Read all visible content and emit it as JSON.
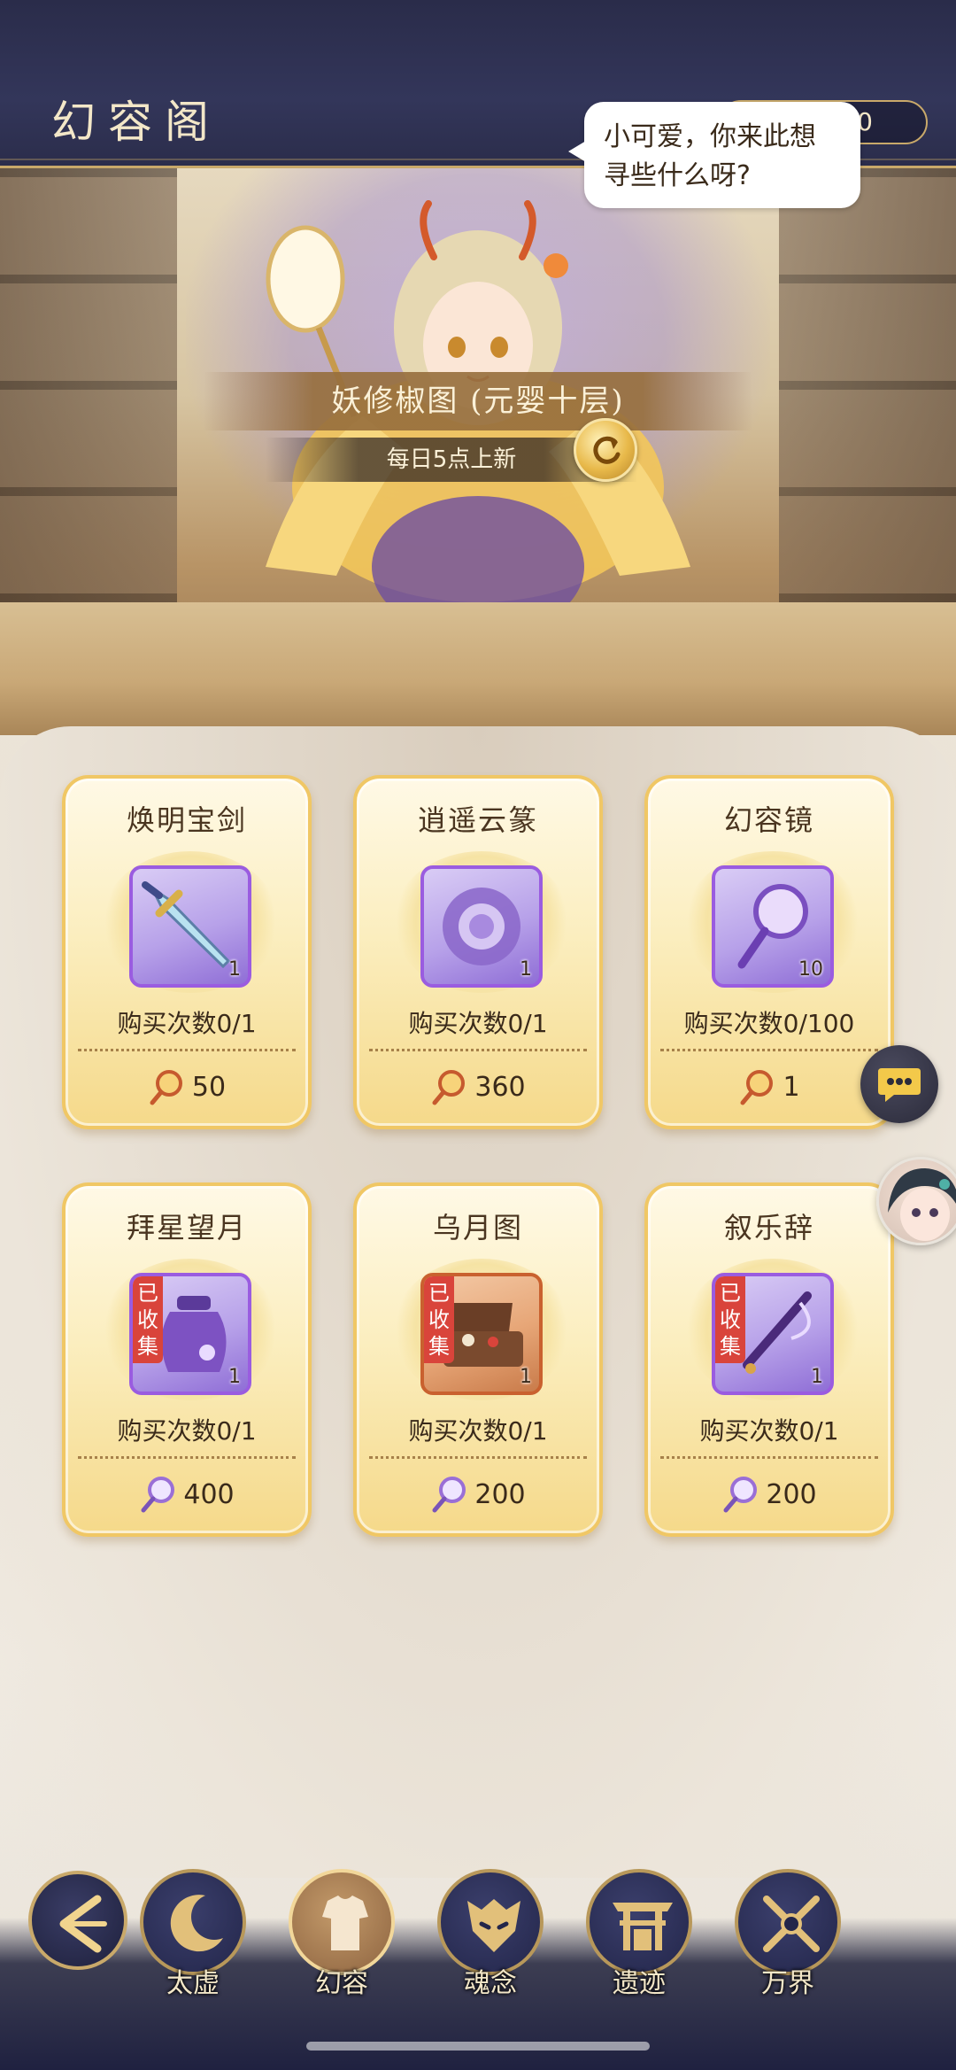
{
  "header": {
    "title": "幻容阁",
    "currency": {
      "icon": "hand-mirror-token-icon",
      "value": "3000"
    }
  },
  "banner": {
    "speech": "小可爱，你来此想寻些什么呀?",
    "shop_title": "妖修椒图 (元婴十层)",
    "refresh_text": "每日5点上新",
    "refresh_icon": "refresh-icon"
  },
  "items": [
    {
      "name": "焕明宝剑",
      "icon": "sword-icon",
      "qty": "1",
      "limit": "购买次数0/1",
      "price": "50",
      "currency_icon": "gold-coin-token-icon",
      "collected": "",
      "frame_color": "#9a5ce0"
    },
    {
      "name": "逍遥云篆",
      "icon": "cloud-seal-icon",
      "qty": "1",
      "limit": "购买次数0/1",
      "price": "360",
      "currency_icon": "gold-coin-token-icon",
      "collected": "",
      "frame_color": "#9a5ce0"
    },
    {
      "name": "幻容镜",
      "icon": "hand-mirror-icon",
      "qty": "10",
      "limit": "购买次数0/100",
      "price": "1",
      "currency_icon": "gold-coin-token-icon",
      "collected": "",
      "frame_color": "#9a5ce0"
    },
    {
      "name": "拜星望月",
      "icon": "jar-icon",
      "qty": "1",
      "limit": "购买次数0/1",
      "price": "400",
      "currency_icon": "hand-mirror-token-icon",
      "collected": "已收集",
      "frame_color": "#9a5ce0"
    },
    {
      "name": "乌月图",
      "icon": "open-chest-icon",
      "qty": "1",
      "limit": "购买次数0/1",
      "price": "200",
      "currency_icon": "hand-mirror-token-icon",
      "collected": "已收集",
      "frame_color": "#c9612f"
    },
    {
      "name": "叙乐辞",
      "icon": "flute-icon",
      "qty": "1",
      "limit": "购买次数0/1",
      "price": "200",
      "currency_icon": "hand-mirror-token-icon",
      "collected": "已收集",
      "frame_color": "#9a5ce0"
    }
  ],
  "floating": {
    "chat_icon": "chat-bubble-icon",
    "avatar_icon": "character-avatar-icon"
  },
  "nav": {
    "back_icon": "back-arrow-icon",
    "tabs": [
      {
        "label": "太虚",
        "icon": "crescent-moon-icon",
        "active": false
      },
      {
        "label": "幻容",
        "icon": "armor-icon",
        "active": true
      },
      {
        "label": "魂念",
        "icon": "mask-icon",
        "active": false
      },
      {
        "label": "遗迹",
        "icon": "shrine-gate-icon",
        "active": false
      },
      {
        "label": "万界",
        "icon": "crossed-weapons-icon",
        "active": false
      }
    ]
  },
  "colors": {
    "header_bg": "#2a2c4a",
    "accent_gold": "#c9a96a",
    "card_border": "#f0c765",
    "collected_badge": "#d9443b",
    "epic_purple": "#9a5ce0"
  }
}
